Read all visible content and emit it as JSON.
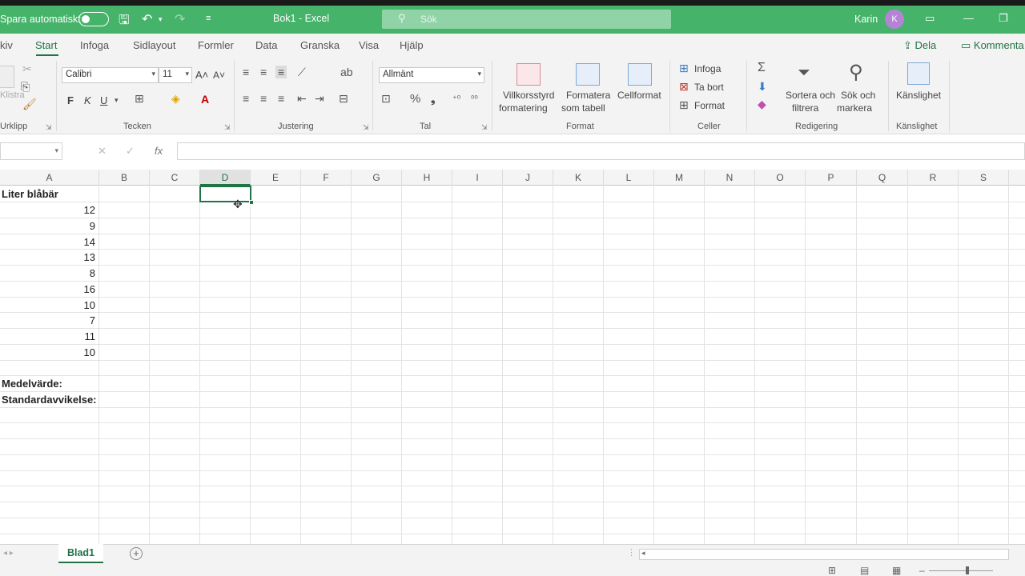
{
  "titlebar": {
    "autosave_label": "Spara automatiskt",
    "doc_title": "Bok1  -  Excel",
    "search_placeholder": "Sök",
    "user_name": "Karin",
    "avatar_initial": "K"
  },
  "menu": {
    "tabs": [
      "kiv",
      "Start",
      "Infoga",
      "Sidlayout",
      "Formler",
      "Data",
      "Granska",
      "Visa",
      "Hjälp"
    ],
    "active_tab": "Start",
    "share": "Dela",
    "comments": "Kommenta"
  },
  "ribbon": {
    "clipboard": {
      "label": "Urklipp",
      "paste": "Klistra"
    },
    "font": {
      "label": "Tecken",
      "font_name": "Calibri",
      "font_size": "11",
      "bold": "F",
      "italic": "K",
      "underline": "U"
    },
    "alignment": {
      "label": "Justering"
    },
    "number": {
      "label": "Tal",
      "format": "Allmänt"
    },
    "styles": {
      "label": "Format",
      "conditional": [
        "Villkorsstyrd",
        "formatering"
      ],
      "as_table": [
        "Formatera",
        "som tabell"
      ],
      "cell_styles": "Cellformat"
    },
    "cells": {
      "label": "Celler",
      "insert": "Infoga",
      "delete": "Ta bort",
      "format": "Format"
    },
    "editing": {
      "label": "Redigering",
      "sort": [
        "Sortera och",
        "filtrera"
      ],
      "find": [
        "Sök och",
        "markera"
      ]
    },
    "sensitivity": {
      "label": "Känslighet",
      "button": "Känslighet"
    }
  },
  "formula_bar": {
    "fx": "fx"
  },
  "grid": {
    "columns": [
      "A",
      "B",
      "C",
      "D",
      "E",
      "F",
      "G",
      "H",
      "I",
      "J",
      "K",
      "L",
      "M",
      "N",
      "O",
      "P",
      "Q",
      "R",
      "S"
    ],
    "selected_column": "D",
    "header_cell": "Liter blåbär",
    "values": [
      "12",
      "9",
      "14",
      "13",
      "8",
      "16",
      "10",
      "7",
      "11",
      "10"
    ],
    "mean_label": "Medelvärde:",
    "std_label": "Standardavvikelse:"
  },
  "sheets": {
    "active": "Blad1"
  }
}
